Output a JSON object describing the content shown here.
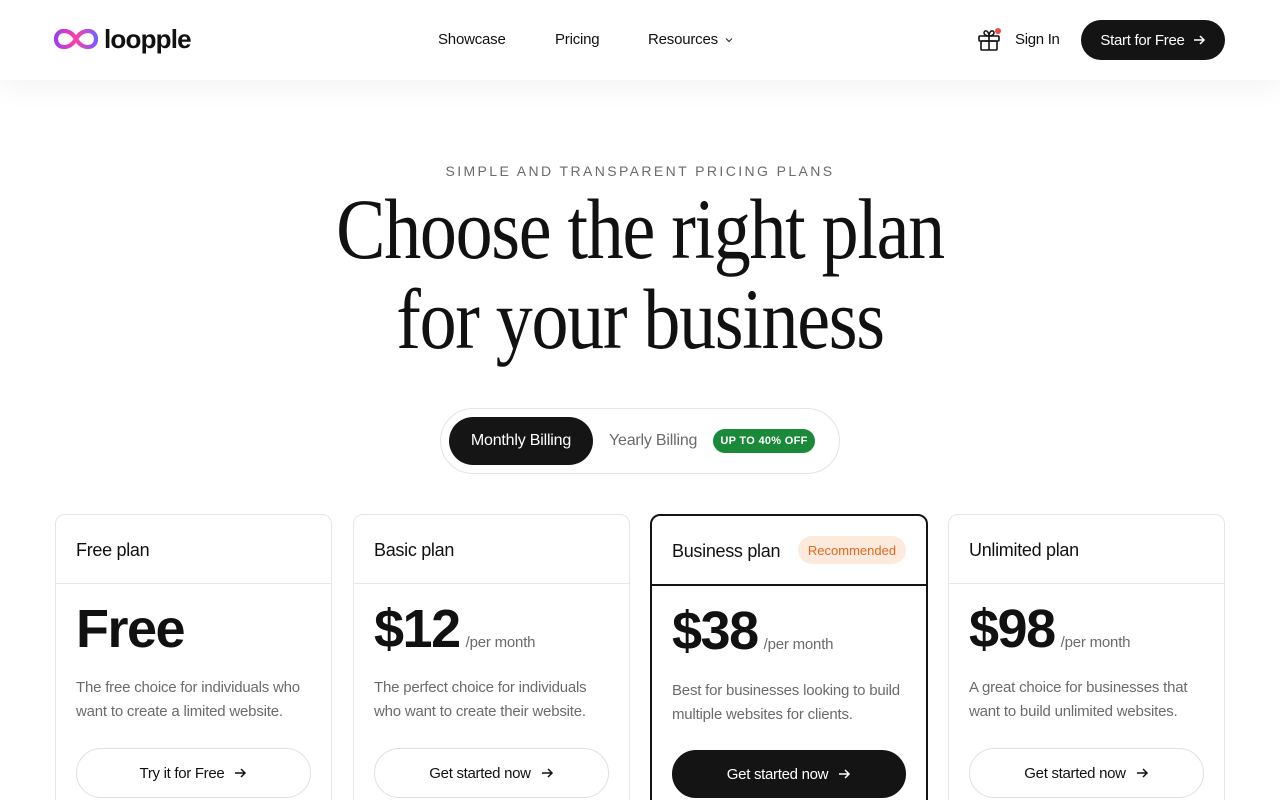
{
  "brand": {
    "name": "loopple"
  },
  "nav": {
    "links": [
      {
        "label": "Showcase"
      },
      {
        "label": "Pricing"
      },
      {
        "label": "Resources"
      }
    ],
    "sign_in": "Sign In",
    "cta": "Start for Free"
  },
  "hero": {
    "eyebrow": "SIMPLE AND TRANSPARENT PRICING PLANS",
    "title_line1": "Choose the right plan",
    "title_line2": "for your business"
  },
  "billing": {
    "monthly": "Monthly Billing",
    "yearly": "Yearly Billing",
    "discount": "UP TO 40% OFF",
    "selected": "Monthly Billing"
  },
  "plans": [
    {
      "name": "Free plan",
      "price": "Free",
      "period": "",
      "description": "The free choice for individuals who want to create a limited website.",
      "button": "Try it for Free"
    },
    {
      "name": "Basic plan",
      "price": "$12",
      "period": "/per month",
      "description": "The perfect choice for individuals who want to create their website.",
      "button": "Get started now"
    },
    {
      "name": "Business plan",
      "badge": "Recommended",
      "price": "$38",
      "period": "/per month",
      "description": "Best for businesses looking to build multiple websites for clients.",
      "button": "Get started now"
    },
    {
      "name": "Unlimited plan",
      "price": "$98",
      "period": "/per month",
      "description": "A great choice for businesses that want to build unlimited websites.",
      "button": "Get started now"
    }
  ],
  "colors": {
    "primary_dark": "#141414",
    "discount_green": "#1a8a3a",
    "badge_bg": "#fdeadc",
    "badge_text": "#e0681e",
    "notification_dot": "#f04a45"
  },
  "icons": [
    "loop-logo-icon",
    "chevron-down-icon",
    "gift-icon",
    "arrow-right-icon"
  ]
}
